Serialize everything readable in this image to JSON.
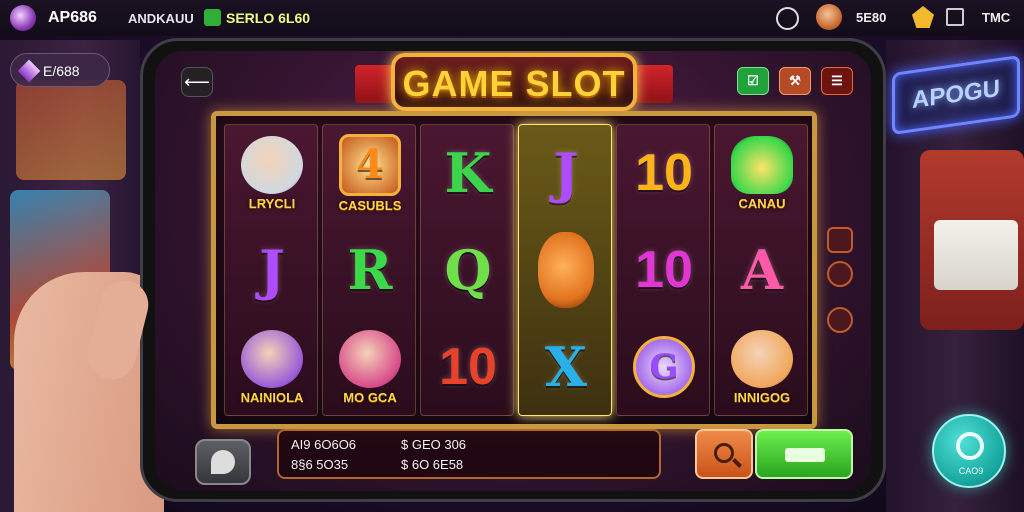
{
  "topbar": {
    "title": "AP686",
    "subtitle": "ANDKAUU",
    "status": "SERLO 6L60",
    "balance": "5E80",
    "currency": "TMC"
  },
  "wallet": {
    "amount": "E/688"
  },
  "background": {
    "neon_sign": "APOGU"
  },
  "game": {
    "title": "GAME SLOT",
    "reels": [
      {
        "highlighted": false,
        "symbols": [
          {
            "type": "portrait",
            "glyph": "",
            "label": "LRYCLI",
            "icon": "knight-portrait-icon",
            "color": "#cfd8e0"
          },
          {
            "type": "letter",
            "glyph": "J",
            "label": "",
            "icon": "",
            "color": "#b04cff"
          },
          {
            "type": "portrait",
            "glyph": "",
            "label": "NAINIOLA",
            "icon": "wizard-portrait-icon",
            "color": "#9a5bd6"
          }
        ]
      },
      {
        "highlighted": false,
        "symbols": [
          {
            "type": "badge",
            "glyph": "4",
            "label": "CASUBLS",
            "icon": "star-badge-icon",
            "color": "#ff8a1a"
          },
          {
            "type": "letter",
            "glyph": "R",
            "label": "",
            "icon": "",
            "color": "#3bd84a"
          },
          {
            "type": "portrait",
            "glyph": "",
            "label": "MO GCA",
            "icon": "magician-portrait-icon",
            "color": "#d84a8a"
          }
        ]
      },
      {
        "highlighted": false,
        "symbols": [
          {
            "type": "letter",
            "glyph": "K",
            "label": "",
            "icon": "",
            "color": "#3cd44a"
          },
          {
            "type": "letter",
            "glyph": "Q",
            "label": "",
            "icon": "",
            "color": "#6fe04a"
          },
          {
            "type": "number",
            "glyph": "10",
            "label": "",
            "icon": "",
            "color": "#e8432a"
          }
        ]
      },
      {
        "highlighted": true,
        "symbols": [
          {
            "type": "letter",
            "glyph": "J",
            "label": "",
            "icon": "",
            "color": "#b04cff"
          },
          {
            "type": "fruit",
            "glyph": "",
            "label": "",
            "icon": "pumpkin-icon",
            "color": "#e2731e"
          },
          {
            "type": "letter",
            "glyph": "X",
            "label": "",
            "icon": "",
            "color": "#2ab0e8"
          }
        ]
      },
      {
        "highlighted": false,
        "symbols": [
          {
            "type": "number",
            "glyph": "10",
            "label": "",
            "icon": "",
            "color": "#ffb31a"
          },
          {
            "type": "number",
            "glyph": "10",
            "label": "",
            "icon": "",
            "color": "#e235d6"
          },
          {
            "type": "coin",
            "glyph": "G",
            "label": "",
            "icon": "coin-icon",
            "color": "#9a4cff"
          }
        ]
      },
      {
        "highlighted": false,
        "symbols": [
          {
            "type": "bag",
            "glyph": "",
            "label": "CANAU",
            "icon": "money-bag-icon",
            "color": "#3bd84a"
          },
          {
            "type": "letter",
            "glyph": "A",
            "label": "",
            "icon": "",
            "color": "#ff5aa8"
          },
          {
            "type": "portrait",
            "glyph": "",
            "label": "INNIGOG",
            "icon": "cat-portrait-icon",
            "color": "#f0a75a"
          }
        ]
      }
    ]
  },
  "info_panel": {
    "line1_left": "AI9 6O6O6",
    "line1_right": "$ GEO 306",
    "line2_left": "8§6 5O35",
    "line2_right": "$ 6O 6E58"
  },
  "float_button": {
    "label": "CAO9"
  },
  "colors": {
    "accent_gold": "#ffd238",
    "spin_green": "#2aa41e",
    "frame_gold": "#c9973f"
  }
}
